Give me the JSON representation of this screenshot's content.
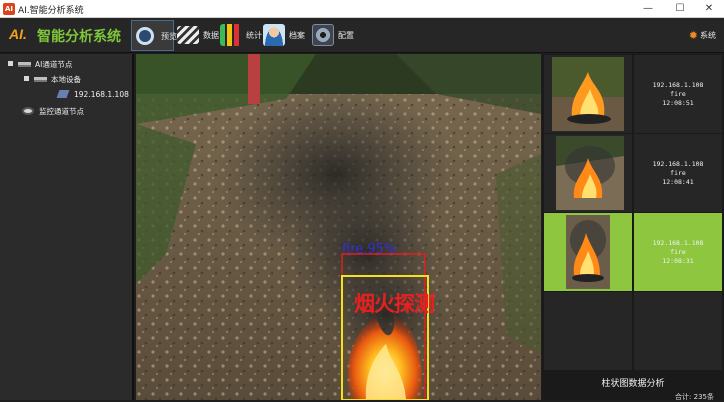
{
  "window": {
    "icon_text": "AI",
    "title": "AI.智能分析系统",
    "minimize": "—",
    "maximize": "☐",
    "close": "✕"
  },
  "toolbar": {
    "logo": "AI.",
    "app_name": "智能分析系统",
    "buttons": [
      {
        "label": "预览",
        "icon": "preview-icon",
        "active": true
      },
      {
        "label": "数据",
        "icon": "clapper-icon",
        "active": false
      },
      {
        "label": "统计",
        "icon": "bar-chart-icon",
        "active": false
      },
      {
        "label": "档案",
        "icon": "profile-icon",
        "active": false
      },
      {
        "label": "配置",
        "icon": "config-gear-icon",
        "active": false
      }
    ],
    "system_label": "系统",
    "system_icon": "gear-icon"
  },
  "tree": {
    "root": "AI通道节点",
    "local_device": "本地设备",
    "camera": "192.168.1.108",
    "monitor_node": "监控通道节点"
  },
  "video": {
    "detection_label": "fire,95%",
    "alert_text": "烟火探测"
  },
  "alerts": [
    {
      "ip": "192.168.1.108",
      "type": "fire",
      "time": "12:08:51",
      "selected": false
    },
    {
      "ip": "192.168.1.108",
      "type": "fire",
      "time": "12:08:41",
      "selected": false
    },
    {
      "ip": "192.168.1.108",
      "type": "fire",
      "time": "12:08:31",
      "selected": true
    }
  ],
  "chart": {
    "title": "柱状图数据分析",
    "total": "合计: 235条"
  },
  "colors": {
    "accent_green": "#8ec640",
    "logo_orange": "#f0a020",
    "box_yellow": "#f5e020",
    "box_red": "#e02020",
    "label_blue": "#3030d8"
  }
}
